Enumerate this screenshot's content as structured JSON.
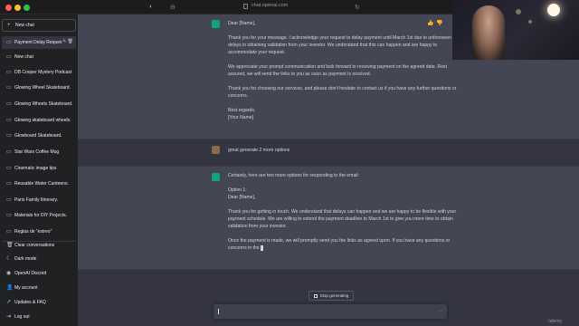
{
  "browser": {
    "url": "chat.openai.com"
  },
  "sidebar": {
    "new_chat_button": "New chat",
    "chats": [
      {
        "label": "New chat",
        "active": false
      },
      {
        "label": "Payment Delay Reques",
        "active": true
      },
      {
        "label": "DB Cooper Mystery Podcast",
        "active": false
      },
      {
        "label": "Glowing Wheel Skateboard.",
        "active": false
      },
      {
        "label": "Glowing Wheels Skateboard.",
        "active": false
      },
      {
        "label": "Glowing skateboard wheels.",
        "active": false
      },
      {
        "label": "Glowboard Skateboard.",
        "active": false
      },
      {
        "label": "Star Wars Coffee Mug",
        "active": false
      },
      {
        "label": "Cinematic image tips",
        "active": false
      },
      {
        "label": "Reusable Water Canteens.",
        "active": false
      },
      {
        "label": "Paris Family Itinerary.",
        "active": false
      },
      {
        "label": "Materials for DIY Projects.",
        "active": false
      },
      {
        "label": "Reglas de \"estreo\"",
        "active": false
      }
    ],
    "bottom": [
      {
        "label": "Clear conversations",
        "icon": "trash-icon"
      },
      {
        "label": "Dark mode",
        "icon": "moon-icon"
      },
      {
        "label": "OpenAI Discord",
        "icon": "discord-icon"
      },
      {
        "label": "My account",
        "icon": "user-icon"
      },
      {
        "label": "Updates & FAQ",
        "icon": "external-link-icon"
      },
      {
        "label": "Log out",
        "icon": "logout-icon"
      }
    ]
  },
  "conversation": {
    "assistant_1": [
      "Dear [Name],",
      "Thank you for your message. I acknowledge your request to delay payment until March 1st due to unforeseen delays in obtaining validation from your investor. We understand that this can happen and are happy to accommodate your request.",
      "We appreciate your prompt communication and look forward to receiving payment on the agreed date. Rest assured, we will send the links to you as soon as payment is received.",
      "Thank you for choosing our services, and please don't hesitate to contact us if you have any further questions or concerns.",
      "Best regards,",
      "[Your Name]"
    ],
    "user_message": "great generate 2 more options",
    "assistant_2": [
      "Certainly, here are two more options for responding to the email:",
      "Option 1:",
      "Dear [Name],",
      "Thank you for getting in touch. We understand that delays can happen and we are happy to be flexible with your payment schedule. We are willing to extend the payment deadline to March 1st to give you more time to obtain validation from your investor.",
      "Once the payment is made, we will promptly send you the links as agreed upon. If you have any questions or concerns in the"
    ]
  },
  "controls": {
    "stop_button": "Stop generating"
  },
  "watermark": "ûdemy",
  "colors": {
    "sidebar_bg": "#202123",
    "main_bg": "#343541",
    "assistant_bg": "#444654",
    "gpt_green": "#10a37f"
  }
}
